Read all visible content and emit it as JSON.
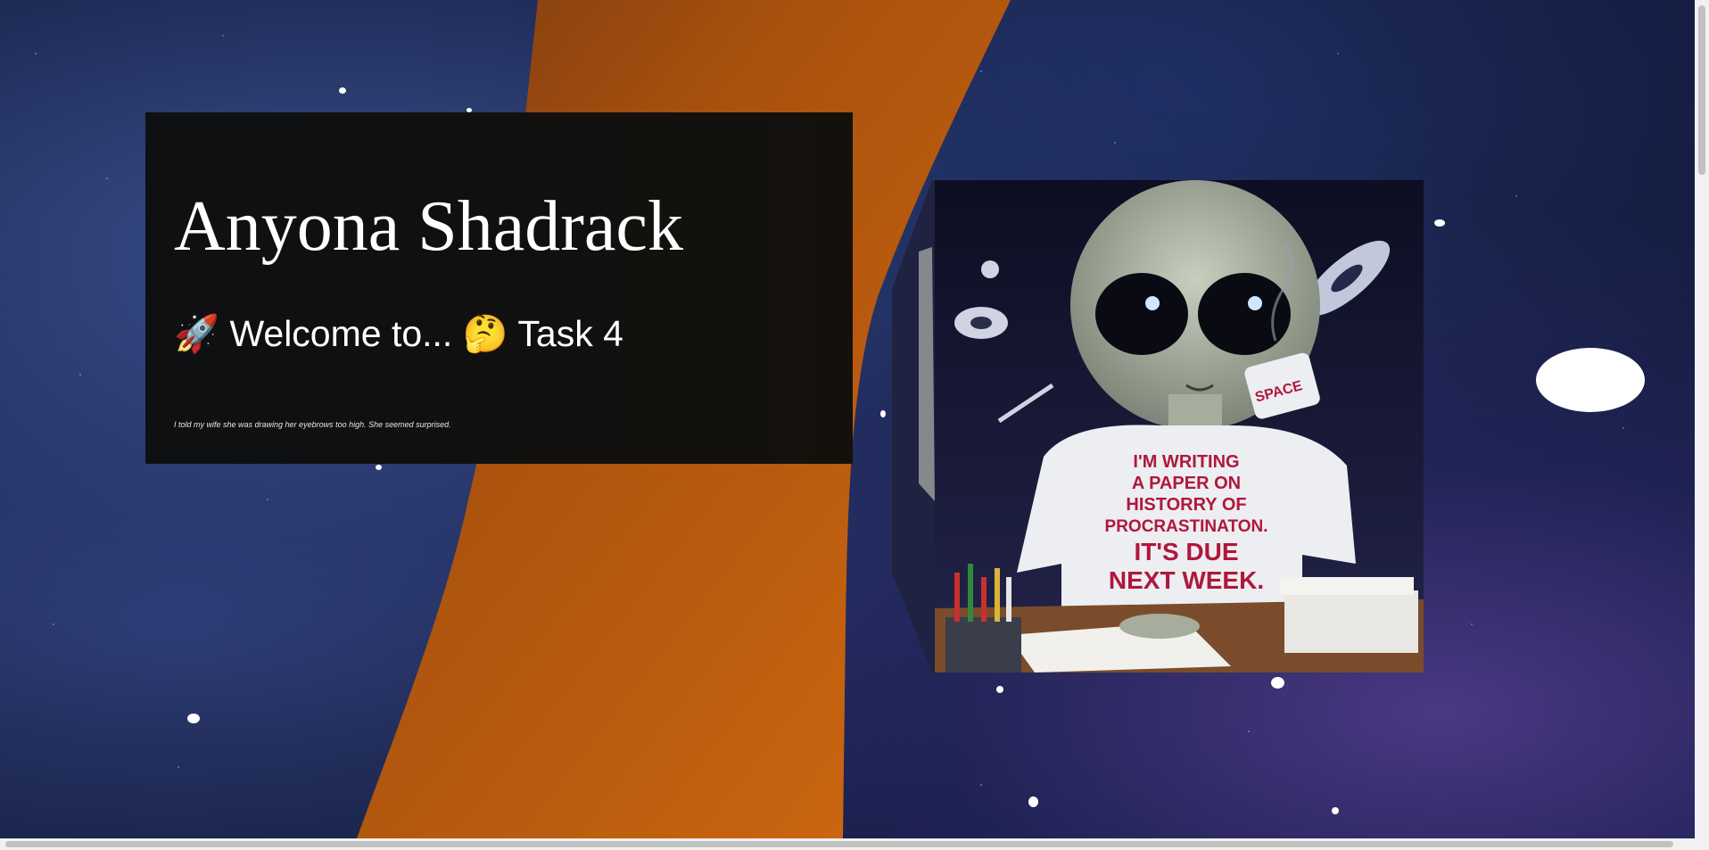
{
  "intro": {
    "name": "Anyona Shadrack",
    "welcome": "🚀 Welcome to... 🤔 Task 4",
    "joke": "I told my wife she was drawing her eyebrows too high. She seemed surprised."
  },
  "image": {
    "alt_text": "I'M WRITING A PAPER ON HISTORRY OF PROCRASTINATON. IT'S DUE NEXT WEEK.",
    "mug_text": "SPACE",
    "shirt_lines": [
      "I'M WRITING",
      "A PAPER ON",
      "HISTORRY OF",
      "PROCRASTINATON.",
      "IT'S DUE",
      "NEXT WEEK."
    ]
  },
  "colors": {
    "orange": "#c4640f",
    "space_dark": "#10183a",
    "card_bg": "#111111",
    "shirt_text": "#b0173b"
  }
}
